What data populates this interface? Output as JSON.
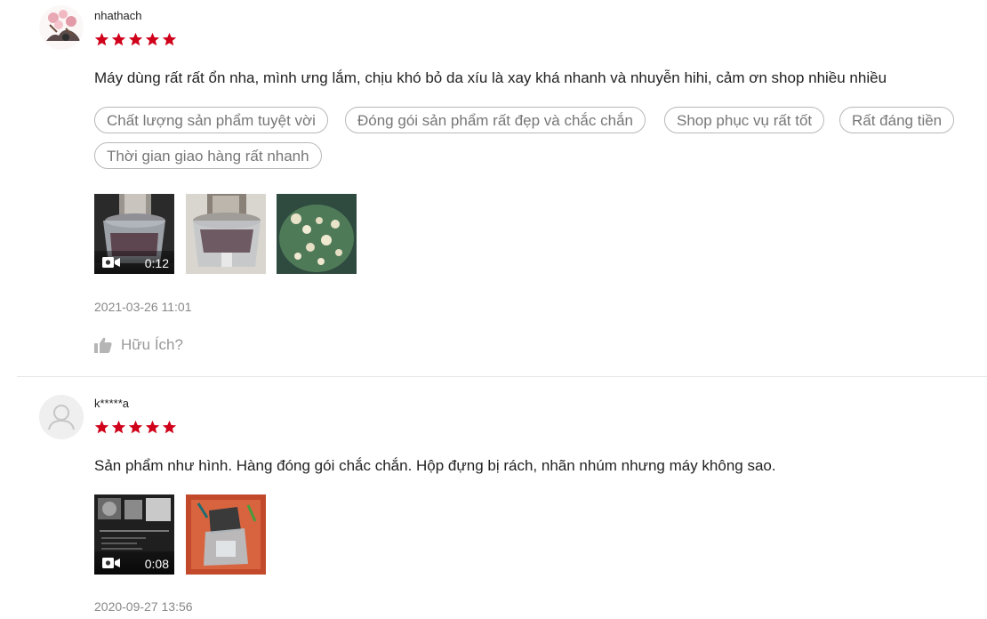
{
  "colors": {
    "star": "#d0011b",
    "tag_border": "#b8b8b8",
    "tag_text": "#777777",
    "meta_text": "#888888"
  },
  "reviews": [
    {
      "username": "nhathach",
      "rating": 5,
      "comment": "Máy dùng rất rất ổn nha, mình ưng lắm, chịu khó bỏ da xíu là xay khá nhanh và nhuyễn hihi, cảm ơn shop nhiều nhiều",
      "tags": [
        "Chất lượng sản phẩm tuyệt vời",
        "Đóng gói sản phẩm rất đẹp và chắc chắn",
        "Shop phục vụ rất tốt",
        "Rất đáng tiền",
        "Thời gian giao hàng rất nhanh"
      ],
      "media": [
        {
          "type": "video",
          "duration": "0:12",
          "icon": "video-camera-icon"
        },
        {
          "type": "image"
        },
        {
          "type": "image"
        }
      ],
      "timestamp": "2021-03-26 11:01",
      "helpful_label": "Hữu Ích?",
      "helpful_icon": "thumbs-up-icon"
    },
    {
      "username": "k*****a",
      "rating": 5,
      "comment": "Sản phẩm như hình. Hàng đóng gói chắc chắn. Hộp đựng bị rách, nhãn nhúm nhưng máy không sao.",
      "media": [
        {
          "type": "video",
          "duration": "0:08",
          "icon": "video-camera-icon"
        },
        {
          "type": "image"
        }
      ],
      "timestamp": "2020-09-27 13:56"
    }
  ]
}
